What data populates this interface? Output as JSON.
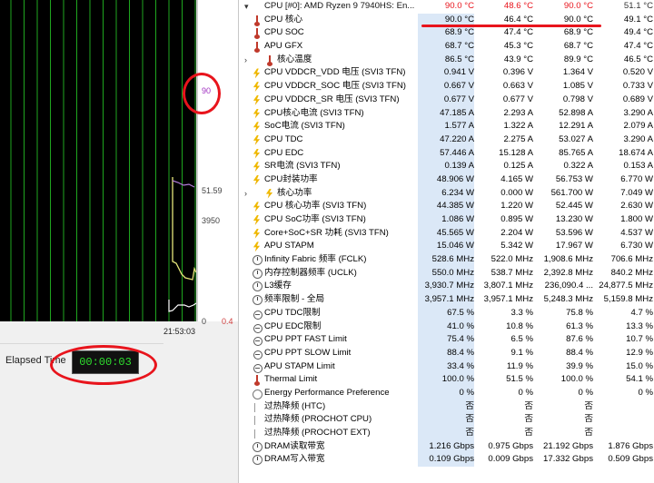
{
  "graph": {
    "peak_label": "90",
    "label_mid": "51.59",
    "label_low": "3950",
    "label_zero": "0",
    "label_right": "0.4",
    "time_label": "21:53:03",
    "colors": {
      "grid": "#1fa61f",
      "bg": "#000000",
      "line_white": "#ffffff",
      "line_yellow": "#e6e67a",
      "line_purple": "#c070e0"
    }
  },
  "elapsed": {
    "label": "Elapsed Time",
    "value": "00:00:03"
  },
  "rows": [
    {
      "type": "header",
      "icon": "chevron",
      "label": "CPU [#0]: AMD Ryzen 9 7940HS: En...",
      "values": [
        "90.0 °C",
        "48.6 °C",
        "90.0 °C",
        "51.1 °C"
      ]
    },
    {
      "icon": "temp",
      "label": "CPU 核心",
      "values": [
        "90.0 °C",
        "46.4 °C",
        "90.0 °C",
        "49.1 °C"
      ]
    },
    {
      "icon": "temp",
      "label": "CPU SOC",
      "values": [
        "68.9 °C",
        "47.4 °C",
        "68.9 °C",
        "49.4 °C"
      ]
    },
    {
      "icon": "temp",
      "label": "APU GFX",
      "values": [
        "68.7 °C",
        "45.3 °C",
        "68.7 °C",
        "47.4 °C"
      ]
    },
    {
      "icon": "temp",
      "label": "核心温度",
      "sub": true,
      "chevron": true,
      "values": [
        "86.5 °C",
        "43.9 °C",
        "89.9 °C",
        "46.5 °C"
      ]
    },
    {
      "icon": "volt",
      "label": "CPU VDDCR_VDD 电压 (SVI3 TFN)",
      "values": [
        "0.941 V",
        "0.396 V",
        "1.364 V",
        "0.520 V"
      ]
    },
    {
      "icon": "volt",
      "label": "CPU VDDCR_SOC 电压 (SVI3 TFN)",
      "values": [
        "0.667 V",
        "0.663 V",
        "1.085 V",
        "0.733 V"
      ]
    },
    {
      "icon": "volt",
      "label": "CPU VDDCR_SR 电压 (SVI3 TFN)",
      "values": [
        "0.677 V",
        "0.677 V",
        "0.798 V",
        "0.689 V"
      ]
    },
    {
      "icon": "volt",
      "label": "CPU核心电流 (SVI3 TFN)",
      "values": [
        "47.185 A",
        "2.293 A",
        "52.898 A",
        "3.290 A"
      ]
    },
    {
      "icon": "volt",
      "label": "SoC电流 (SVI3 TFN)",
      "values": [
        "1.577 A",
        "1.322 A",
        "12.291 A",
        "2.079 A"
      ]
    },
    {
      "icon": "volt",
      "label": "CPU TDC",
      "values": [
        "47.220 A",
        "2.275 A",
        "53.027 A",
        "3.290 A"
      ]
    },
    {
      "icon": "volt",
      "label": "CPU EDC",
      "values": [
        "57.446 A",
        "15.128 A",
        "85.765 A",
        "18.674 A"
      ]
    },
    {
      "icon": "volt",
      "label": "SR电流 (SVI3 TFN)",
      "values": [
        "0.139 A",
        "0.125 A",
        "0.322 A",
        "0.153 A"
      ]
    },
    {
      "icon": "volt",
      "label": "CPU封装功率",
      "values": [
        "48.906 W",
        "4.165 W",
        "56.753 W",
        "6.770 W"
      ]
    },
    {
      "icon": "volt",
      "label": "核心功率",
      "sub": true,
      "chevron": true,
      "values": [
        "6.234 W",
        "0.000 W",
        "561.700 W",
        "7.049 W"
      ]
    },
    {
      "icon": "volt",
      "label": "CPU 核心功率 (SVI3 TFN)",
      "values": [
        "44.385 W",
        "1.220 W",
        "52.445 W",
        "2.630 W"
      ]
    },
    {
      "icon": "volt",
      "label": "CPU SoC功率 (SVI3 TFN)",
      "values": [
        "1.086 W",
        "0.895 W",
        "13.230 W",
        "1.800 W"
      ]
    },
    {
      "icon": "volt",
      "label": "Core+SoC+SR 功耗 (SVI3 TFN)",
      "values": [
        "45.565 W",
        "2.204 W",
        "53.596 W",
        "4.537 W"
      ]
    },
    {
      "icon": "volt",
      "label": "APU STAPM",
      "values": [
        "15.046 W",
        "5.342 W",
        "17.967 W",
        "6.730 W"
      ]
    },
    {
      "icon": "clock",
      "label": "Infinity Fabric 频率 (FCLK)",
      "values": [
        "528.6 MHz",
        "522.0 MHz",
        "1,908.6 MHz",
        "706.6 MHz"
      ]
    },
    {
      "icon": "clock",
      "label": "内存控制器频率 (UCLK)",
      "values": [
        "550.0 MHz",
        "538.7 MHz",
        "2,392.8 MHz",
        "840.2 MHz"
      ]
    },
    {
      "icon": "clock",
      "label": "L3缓存",
      "values": [
        "3,930.7 MHz",
        "3,807.1 MHz",
        "236,090.4 ...",
        "24,877.5 MHz"
      ]
    },
    {
      "icon": "clock",
      "label": "频率限制 - 全局",
      "values": [
        "3,957.1 MHz",
        "3,957.1 MHz",
        "5,248.3 MHz",
        "5,159.8 MHz"
      ]
    },
    {
      "icon": "bar",
      "label": "CPU TDC限制",
      "values": [
        "67.5 %",
        "3.3 %",
        "75.8 %",
        "4.7 %"
      ]
    },
    {
      "icon": "bar",
      "label": "CPU EDC限制",
      "values": [
        "41.0 %",
        "10.8 %",
        "61.3 %",
        "13.3 %"
      ]
    },
    {
      "icon": "bar",
      "label": "CPU PPT FAST Limit",
      "values": [
        "75.4 %",
        "6.5 %",
        "87.6 %",
        "10.7 %"
      ]
    },
    {
      "icon": "bar",
      "label": "CPU PPT SLOW Limit",
      "values": [
        "88.4 %",
        "9.1 %",
        "88.4 %",
        "12.9 %"
      ]
    },
    {
      "icon": "bar",
      "label": "APU STAPM Limit",
      "values": [
        "33.4 %",
        "11.9 %",
        "39.9 %",
        "15.0 %"
      ]
    },
    {
      "icon": "temp",
      "label": "Thermal Limit",
      "values": [
        "100.0 %",
        "51.5 %",
        "100.0 %",
        "54.1 %"
      ]
    },
    {
      "icon": "ok",
      "label": "Energy Performance Preference",
      "values": [
        "0 %",
        "0 %",
        "0 %",
        "0 %"
      ]
    },
    {
      "icon": "none",
      "label": "过热降频 (HTC)",
      "values": [
        "否",
        "否",
        "否",
        ""
      ]
    },
    {
      "icon": "none",
      "label": "过热降频 (PROCHOT CPU)",
      "values": [
        "否",
        "否",
        "否",
        ""
      ]
    },
    {
      "icon": "none",
      "label": "过热降频 (PROCHOT EXT)",
      "values": [
        "否",
        "否",
        "否",
        ""
      ]
    },
    {
      "icon": "clock",
      "label": "DRAM读取带宽",
      "values": [
        "1.216 Gbps",
        "0.975 Gbps",
        "21.192 Gbps",
        "1.876 Gbps"
      ]
    },
    {
      "icon": "clock",
      "label": "DRAM写入带宽",
      "values": [
        "0.109 Gbps",
        "0.009 Gbps",
        "17.332 Gbps",
        "0.509 Gbps"
      ]
    }
  ]
}
